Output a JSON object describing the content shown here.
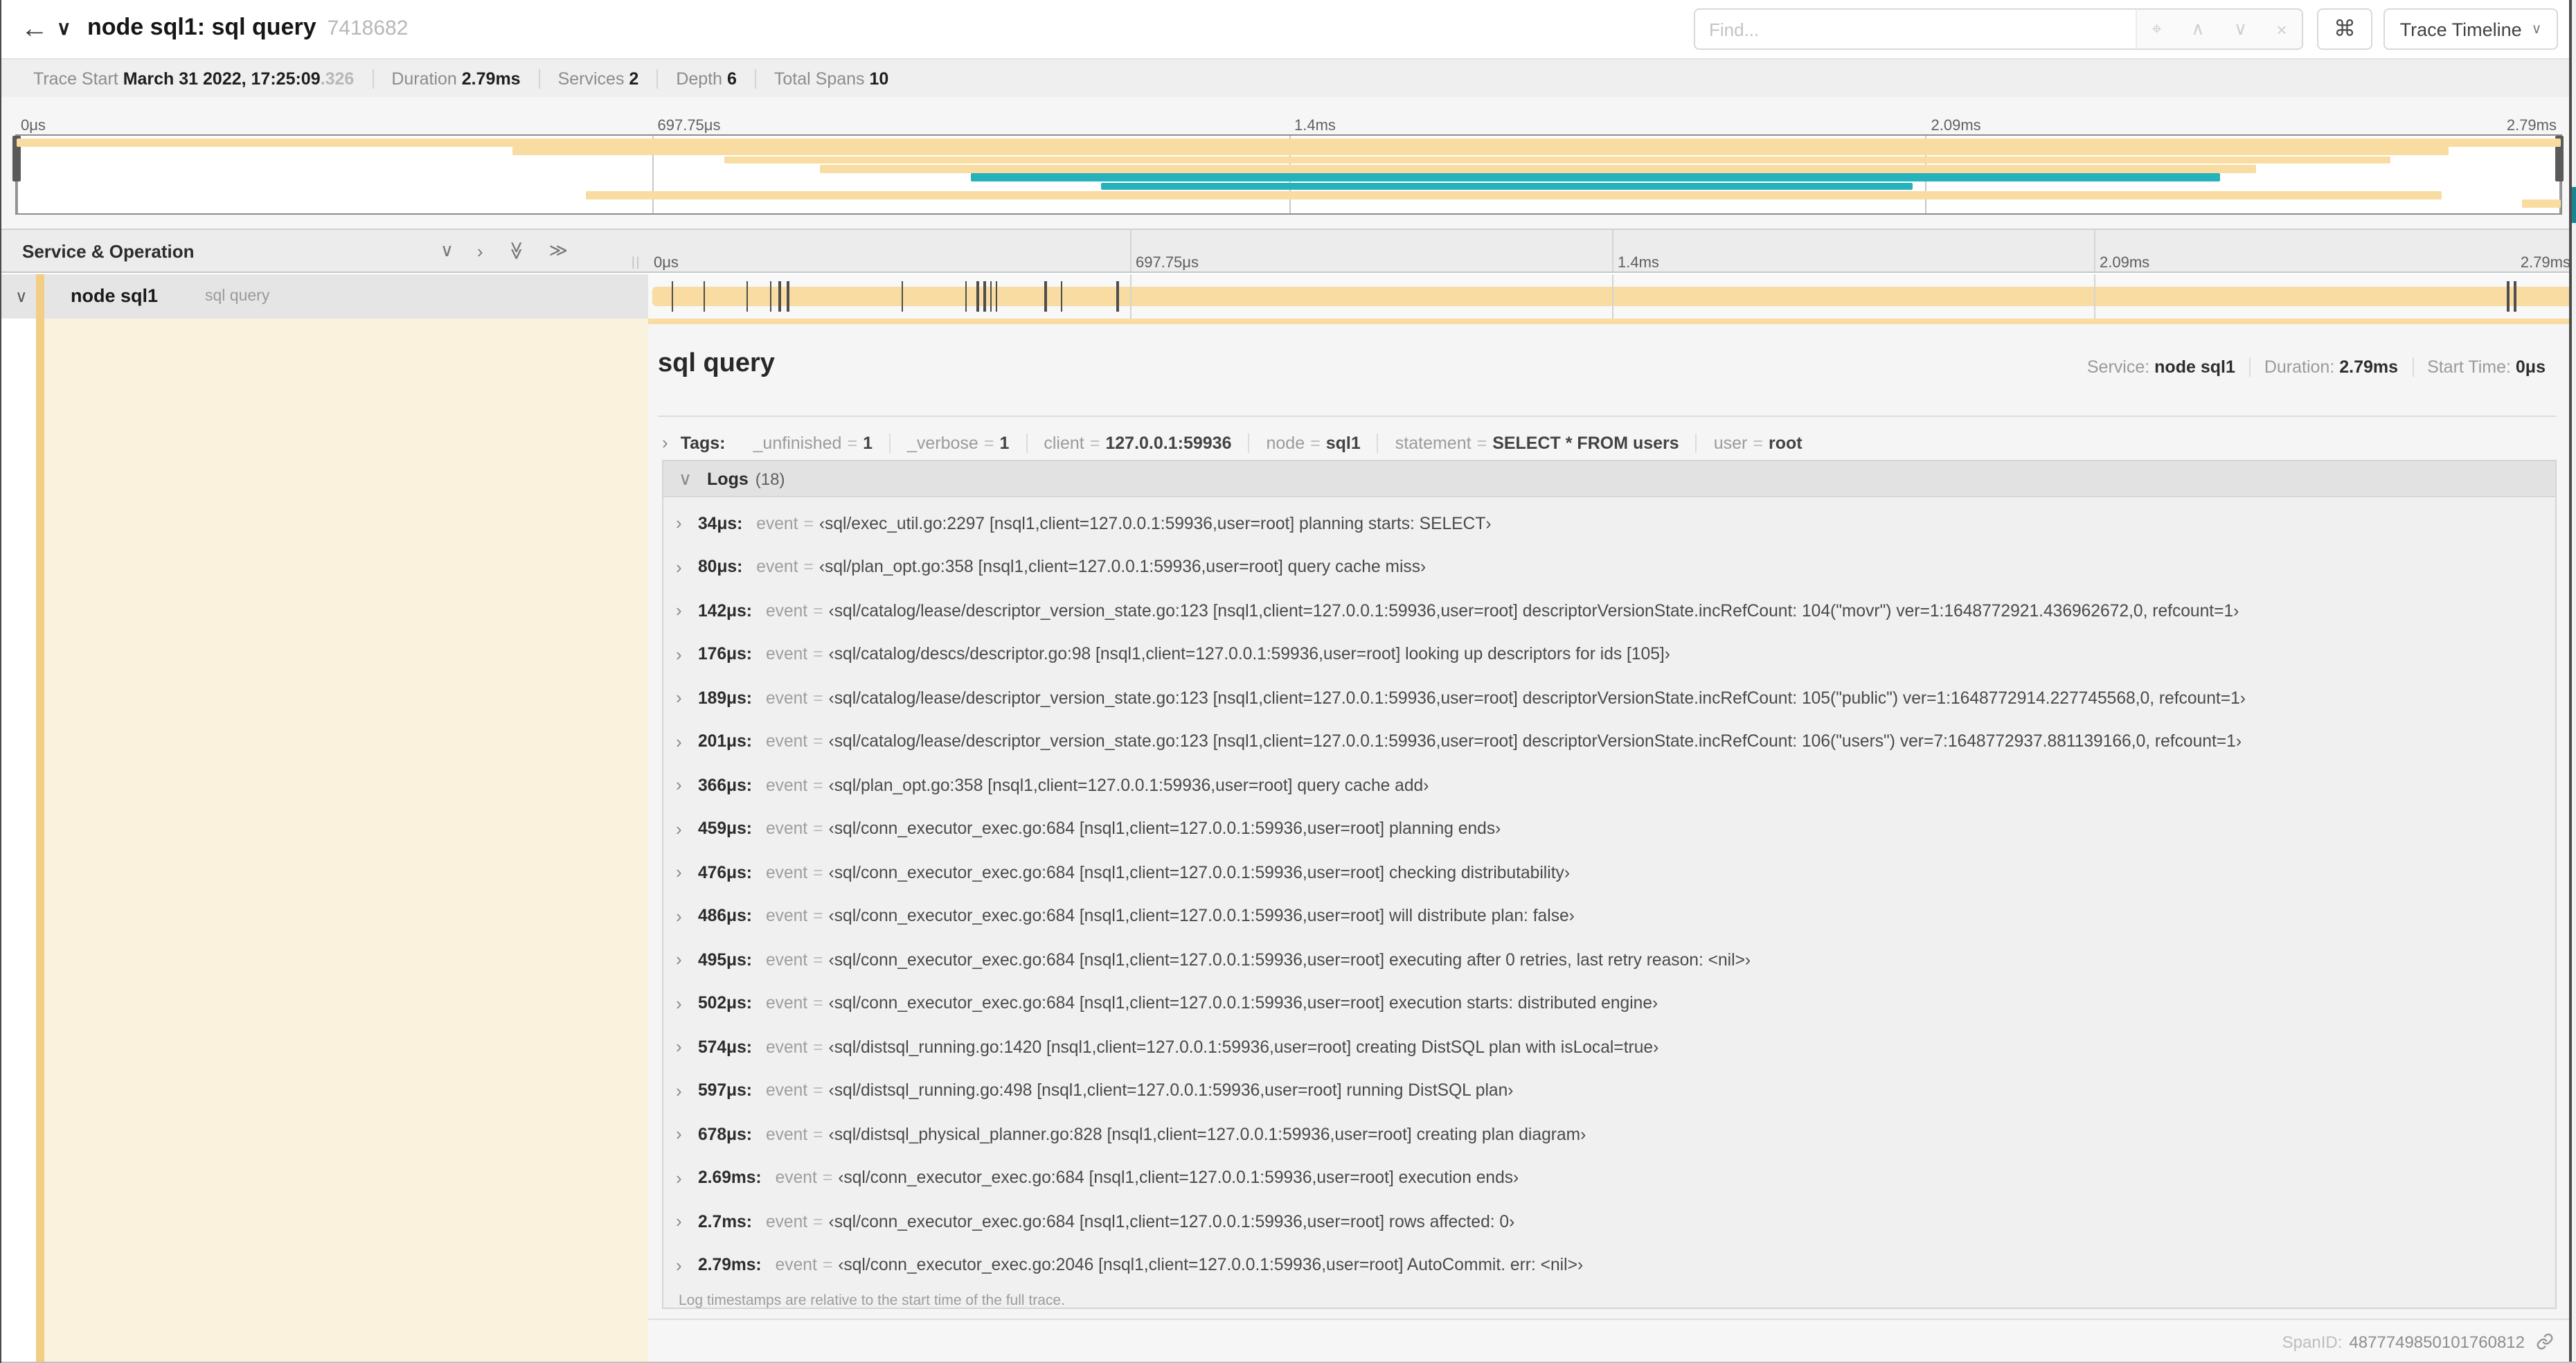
{
  "icons": {
    "back_arrow": "←",
    "chevron_down": "∨",
    "chevron_right": "›",
    "grip": "||"
  },
  "colors": {
    "tan": "#F8DCA1",
    "teal": "#26B2BA",
    "colorbar": "#F2CD85",
    "cream": "#FBF2DD",
    "edge_teal": "#1A8490"
  },
  "header": {
    "title": "node sql1: sql query",
    "trace_id_short": "7418682",
    "find_placeholder": "Find...",
    "find_icons": [
      {
        "glyph": "⌖",
        "name": "locate-match-icon"
      },
      {
        "glyph": "∧",
        "name": "prev-match-icon"
      },
      {
        "glyph": "∨",
        "name": "next-match-icon"
      },
      {
        "glyph": "×",
        "name": "clear-search-icon"
      }
    ],
    "shortcut_button": "⌘",
    "view_selector": "Trace Timeline"
  },
  "trace_info": {
    "items": [
      {
        "label": "Trace Start",
        "value": "March 31 2022, 17:25:09",
        "suffix": ".326"
      },
      {
        "label": "Duration",
        "value": "2.79ms"
      },
      {
        "label": "Services",
        "value": "2"
      },
      {
        "label": "Depth",
        "value": "6"
      },
      {
        "label": "Total Spans",
        "value": "10"
      }
    ]
  },
  "timeline_ticks": [
    "0μs",
    "697.75μs",
    "1.4ms",
    "2.09ms",
    "2.79ms"
  ],
  "grid_fractions": [
    0.25,
    0.5,
    0.75
  ],
  "minimap": {
    "spans": [
      {
        "start": 0,
        "end": 1,
        "color": "tan"
      },
      {
        "start": 0.195,
        "end": 0.956,
        "color": "tan"
      },
      {
        "start": 0.278,
        "end": 0.933,
        "color": "tan"
      },
      {
        "start": 0.316,
        "end": 0.88,
        "color": "tan"
      },
      {
        "start": 0.375,
        "end": 0.866,
        "color": "teal"
      },
      {
        "start": 0.426,
        "end": 0.745,
        "color": "teal"
      },
      {
        "start": 0.224,
        "end": 0.953,
        "color": "tan"
      },
      {
        "start": 0.985,
        "end": 1,
        "color": "tan"
      }
    ]
  },
  "timeline_header": {
    "left_title": "Service & Operation",
    "collapse_icons": [
      {
        "glyph": "∨",
        "name": "expand-one-icon",
        "rotate": false
      },
      {
        "glyph": "›",
        "name": "collapse-one-icon",
        "rotate": false
      },
      {
        "glyph": "≫",
        "name": "expand-all-icon",
        "rotate": true
      },
      {
        "glyph": "≫",
        "name": "collapse-all-icon",
        "rotate": false
      }
    ]
  },
  "span_row": {
    "service": "node sql1",
    "operation": "sql query",
    "log_tick_fractions": [
      0.0122,
      0.0287,
      0.0509,
      0.0631,
      0.0678,
      0.072,
      0.1312,
      0.1645,
      0.1706,
      0.1742,
      0.1774,
      0.18,
      0.2057,
      0.214,
      0.243,
      0.9642,
      0.9677
    ]
  },
  "detail": {
    "title": "sql query",
    "meta": [
      {
        "label": "Service:",
        "value": "node sql1"
      },
      {
        "label": "Duration:",
        "value": "2.79ms"
      },
      {
        "label": "Start Time:",
        "value": "0μs"
      }
    ],
    "tags_label": "Tags:",
    "tags": [
      {
        "key": "_unfinished",
        "value": "1"
      },
      {
        "key": "_verbose",
        "value": "1"
      },
      {
        "key": "client",
        "value": "127.0.0.1:59936"
      },
      {
        "key": "node",
        "value": "sql1"
      },
      {
        "key": "statement",
        "value": "SELECT * FROM users"
      },
      {
        "key": "user",
        "value": "root"
      }
    ],
    "logs_label": "Logs",
    "logs_count": "(18)",
    "logs": [
      {
        "time": "34μs:",
        "key": "event",
        "value": "‹sql/exec_util.go:2297 [nsql1,client=127.0.0.1:59936,user=root] planning starts: SELECT›"
      },
      {
        "time": "80μs:",
        "key": "event",
        "value": "‹sql/plan_opt.go:358 [nsql1,client=127.0.0.1:59936,user=root] query cache miss›"
      },
      {
        "time": "142μs:",
        "key": "event",
        "value": "‹sql/catalog/lease/descriptor_version_state.go:123 [nsql1,client=127.0.0.1:59936,user=root] descriptorVersionState.incRefCount: 104(\"movr\") ver=1:1648772921.436962672,0, refcount=1›"
      },
      {
        "time": "176μs:",
        "key": "event",
        "value": "‹sql/catalog/descs/descriptor.go:98 [nsql1,client=127.0.0.1:59936,user=root] looking up descriptors for ids [105]›"
      },
      {
        "time": "189μs:",
        "key": "event",
        "value": "‹sql/catalog/lease/descriptor_version_state.go:123 [nsql1,client=127.0.0.1:59936,user=root] descriptorVersionState.incRefCount: 105(\"public\") ver=1:1648772914.227745568,0, refcount=1›"
      },
      {
        "time": "201μs:",
        "key": "event",
        "value": "‹sql/catalog/lease/descriptor_version_state.go:123 [nsql1,client=127.0.0.1:59936,user=root] descriptorVersionState.incRefCount: 106(\"users\") ver=7:1648772937.881139166,0, refcount=1›"
      },
      {
        "time": "366μs:",
        "key": "event",
        "value": "‹sql/plan_opt.go:358 [nsql1,client=127.0.0.1:59936,user=root] query cache add›"
      },
      {
        "time": "459μs:",
        "key": "event",
        "value": "‹sql/conn_executor_exec.go:684 [nsql1,client=127.0.0.1:59936,user=root] planning ends›"
      },
      {
        "time": "476μs:",
        "key": "event",
        "value": "‹sql/conn_executor_exec.go:684 [nsql1,client=127.0.0.1:59936,user=root] checking distributability›"
      },
      {
        "time": "486μs:",
        "key": "event",
        "value": "‹sql/conn_executor_exec.go:684 [nsql1,client=127.0.0.1:59936,user=root] will distribute plan: false›"
      },
      {
        "time": "495μs:",
        "key": "event",
        "value": "‹sql/conn_executor_exec.go:684 [nsql1,client=127.0.0.1:59936,user=root] executing after 0 retries, last retry reason: <nil>›"
      },
      {
        "time": "502μs:",
        "key": "event",
        "value": "‹sql/conn_executor_exec.go:684 [nsql1,client=127.0.0.1:59936,user=root] execution starts: distributed engine›"
      },
      {
        "time": "574μs:",
        "key": "event",
        "value": "‹sql/distsql_running.go:1420 [nsql1,client=127.0.0.1:59936,user=root] creating DistSQL plan with isLocal=true›"
      },
      {
        "time": "597μs:",
        "key": "event",
        "value": "‹sql/distsql_running.go:498 [nsql1,client=127.0.0.1:59936,user=root] running DistSQL plan›"
      },
      {
        "time": "678μs:",
        "key": "event",
        "value": "‹sql/distsql_physical_planner.go:828 [nsql1,client=127.0.0.1:59936,user=root] creating plan diagram›"
      },
      {
        "time": "2.69ms:",
        "key": "event",
        "value": "‹sql/conn_executor_exec.go:684 [nsql1,client=127.0.0.1:59936,user=root] execution ends›"
      },
      {
        "time": "2.7ms:",
        "key": "event",
        "value": "‹sql/conn_executor_exec.go:684 [nsql1,client=127.0.0.1:59936,user=root] rows affected: 0›"
      },
      {
        "time": "2.79ms:",
        "key": "event",
        "value": "‹sql/conn_executor_exec.go:2046 [nsql1,client=127.0.0.1:59936,user=root] AutoCommit. err: <nil>›"
      }
    ],
    "logs_note": "Log timestamps are relative to the start time of the full trace.",
    "span_id_label": "SpanID:",
    "span_id": "4877749850101760812"
  }
}
